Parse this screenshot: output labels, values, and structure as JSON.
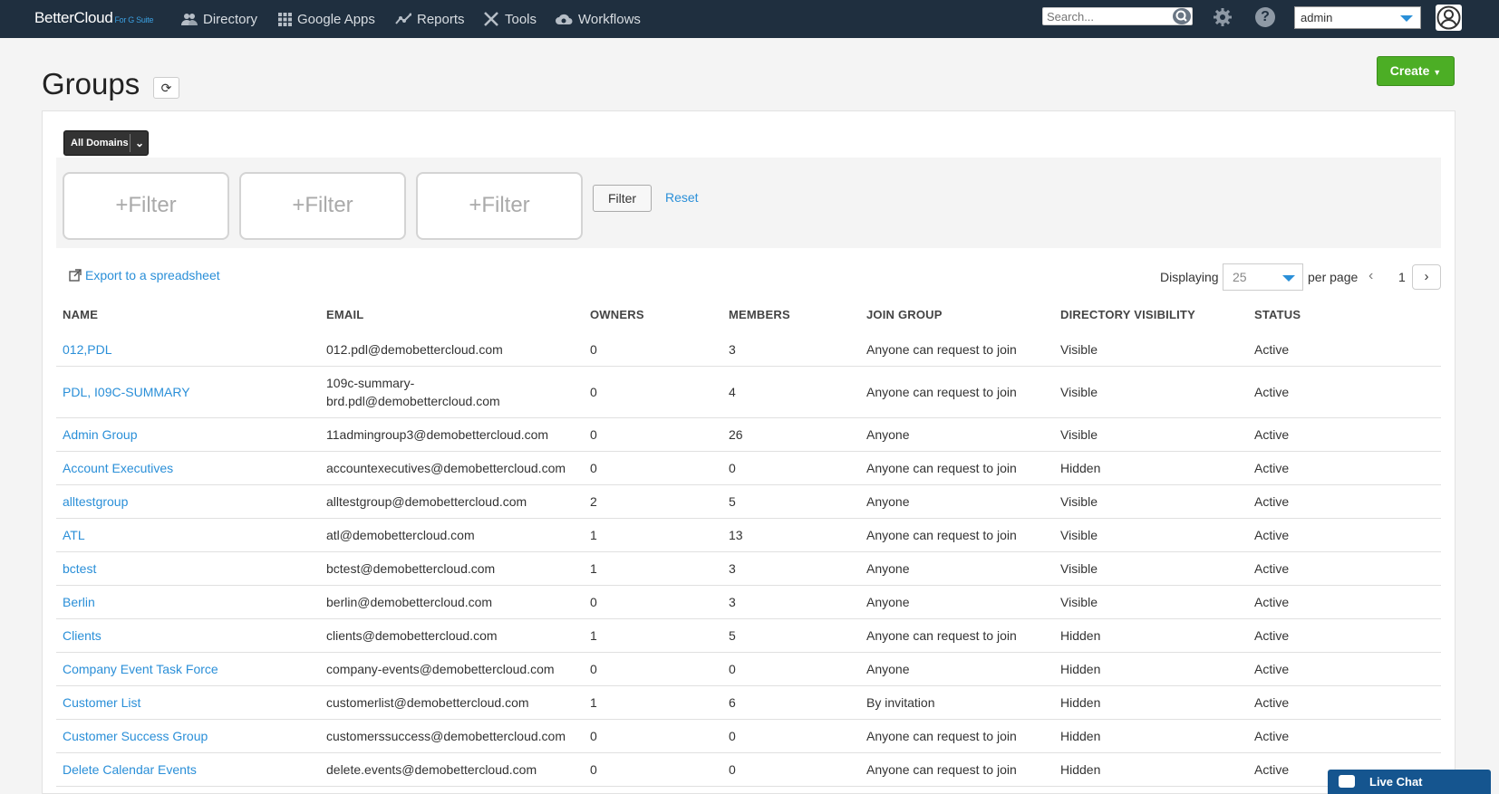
{
  "app": {
    "logo": "BetterCloud",
    "logo_sub": "For G Suite"
  },
  "nav": {
    "items": [
      {
        "label": "Directory",
        "icon": "users-icon"
      },
      {
        "label": "Google Apps",
        "icon": "grid-icon"
      },
      {
        "label": "Reports",
        "icon": "chart-icon"
      },
      {
        "label": "Tools",
        "icon": "tools-icon"
      },
      {
        "label": "Workflows",
        "icon": "cloud-gear-icon"
      }
    ],
    "search_placeholder": "Search...",
    "user_select": "admin"
  },
  "header": {
    "title": "Groups",
    "create_label": "Create"
  },
  "filters": {
    "domains_label": "All Domains",
    "boxes": [
      "+Filter",
      "+Filter",
      "+Filter"
    ],
    "filter_label": "Filter",
    "reset_label": "Reset"
  },
  "toolbar": {
    "export_label": "Export to a spreadsheet",
    "displaying_label": "Displaying",
    "per_page_value": "25",
    "per_page_label": "per page",
    "page": "1"
  },
  "table": {
    "columns": [
      "NAME",
      "EMAIL",
      "OWNERS",
      "MEMBERS",
      "JOIN GROUP",
      "DIRECTORY VISIBILITY",
      "STATUS"
    ],
    "rows": [
      {
        "name": "012,PDL",
        "email": "012.pdl@demobettercloud.com",
        "owners": "0",
        "members": "3",
        "join": "Anyone can request to join",
        "visibility": "Visible",
        "status": "Active"
      },
      {
        "name": "PDL, I09C-SUMMARY",
        "email": "109c-summary-",
        "email2": "brd.pdl@demobettercloud.com",
        "owners": "0",
        "members": "4",
        "join": "Anyone can request to join",
        "visibility": "Visible",
        "status": "Active"
      },
      {
        "name": "Admin Group",
        "email": "11admingroup3@demobettercloud.com",
        "owners": "0",
        "members": "26",
        "join": "Anyone",
        "visibility": "Visible",
        "status": "Active"
      },
      {
        "name": "Account Executives",
        "email": "accountexecutives@demobettercloud.com",
        "owners": "0",
        "members": "0",
        "join": "Anyone can request to join",
        "visibility": "Hidden",
        "status": "Active"
      },
      {
        "name": "alltestgroup",
        "email": "alltestgroup@demobettercloud.com",
        "owners": "2",
        "members": "5",
        "join": "Anyone",
        "visibility": "Visible",
        "status": "Active"
      },
      {
        "name": "ATL",
        "email": "atl@demobettercloud.com",
        "owners": "1",
        "members": "13",
        "join": "Anyone can request to join",
        "visibility": "Visible",
        "status": "Active"
      },
      {
        "name": "bctest",
        "email": "bctest@demobettercloud.com",
        "owners": "1",
        "members": "3",
        "join": "Anyone",
        "visibility": "Visible",
        "status": "Active"
      },
      {
        "name": "Berlin",
        "email": "berlin@demobettercloud.com",
        "owners": "0",
        "members": "3",
        "join": "Anyone",
        "visibility": "Visible",
        "status": "Active"
      },
      {
        "name": "Clients",
        "email": "clients@demobettercloud.com",
        "owners": "1",
        "members": "5",
        "join": "Anyone can request to join",
        "visibility": "Hidden",
        "status": "Active"
      },
      {
        "name": "Company Event Task Force",
        "email": "company-events@demobettercloud.com",
        "owners": "0",
        "members": "0",
        "join": "Anyone",
        "visibility": "Hidden",
        "status": "Active"
      },
      {
        "name": "Customer List",
        "email": "customerlist@demobettercloud.com",
        "owners": "1",
        "members": "6",
        "join": "By invitation",
        "visibility": "Hidden",
        "status": "Active"
      },
      {
        "name": "Customer Success Group",
        "email": "customerssuccess@demobettercloud.com",
        "owners": "0",
        "members": "0",
        "join": "Anyone can request to join",
        "visibility": "Hidden",
        "status": "Active"
      },
      {
        "name": "Delete Calendar Events",
        "email": "delete.events@demobettercloud.com",
        "owners": "0",
        "members": "0",
        "join": "Anyone can request to join",
        "visibility": "Hidden",
        "status": "Active"
      }
    ]
  },
  "chat": {
    "label": "Live Chat"
  },
  "colors": {
    "topbar": "#1f2f3f",
    "link": "#2a8fd8",
    "create": "#4cae25",
    "chat": "#15558f"
  }
}
